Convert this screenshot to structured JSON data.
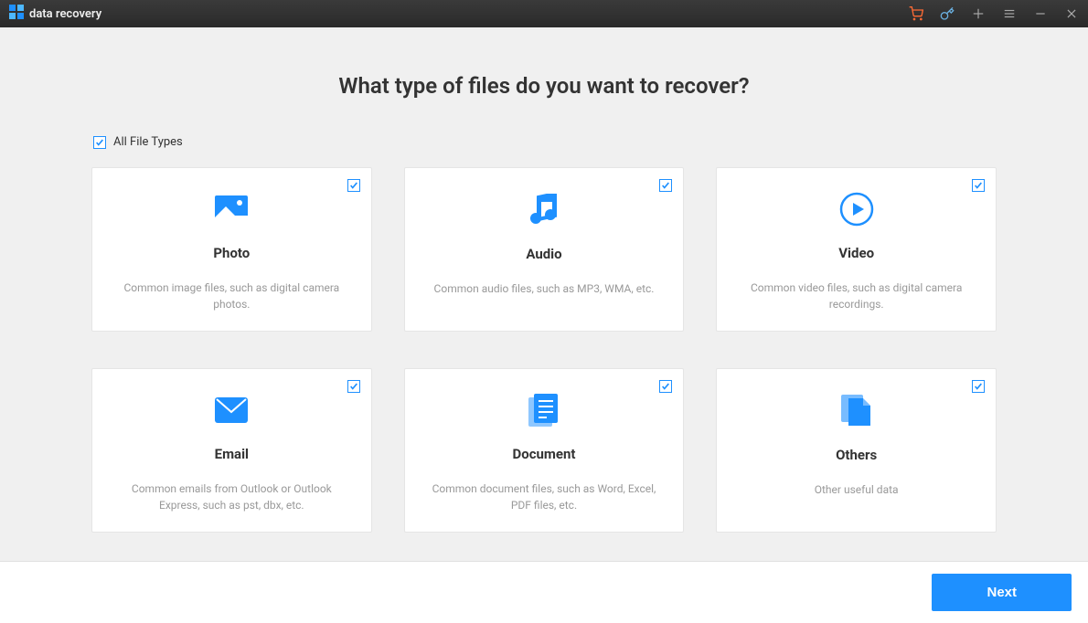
{
  "app": {
    "title": "data recovery"
  },
  "page": {
    "heading": "What type of files do you want to recover?",
    "all_types_label": "All File Types"
  },
  "cards": [
    {
      "title": "Photo",
      "desc": "Common image files, such as digital camera photos."
    },
    {
      "title": "Audio",
      "desc": "Common audio files, such as MP3, WMA, etc."
    },
    {
      "title": "Video",
      "desc": "Common video files, such as digital camera recordings."
    },
    {
      "title": "Email",
      "desc": "Common emails from Outlook or Outlook Express, such as pst, dbx, etc."
    },
    {
      "title": "Document",
      "desc": "Common document files, such as Word, Excel, PDF files, etc."
    },
    {
      "title": "Others",
      "desc": "Other useful data"
    }
  ],
  "footer": {
    "next_label": "Next"
  },
  "colors": {
    "accent": "#1e90ff",
    "cart": "#ff6b35"
  }
}
